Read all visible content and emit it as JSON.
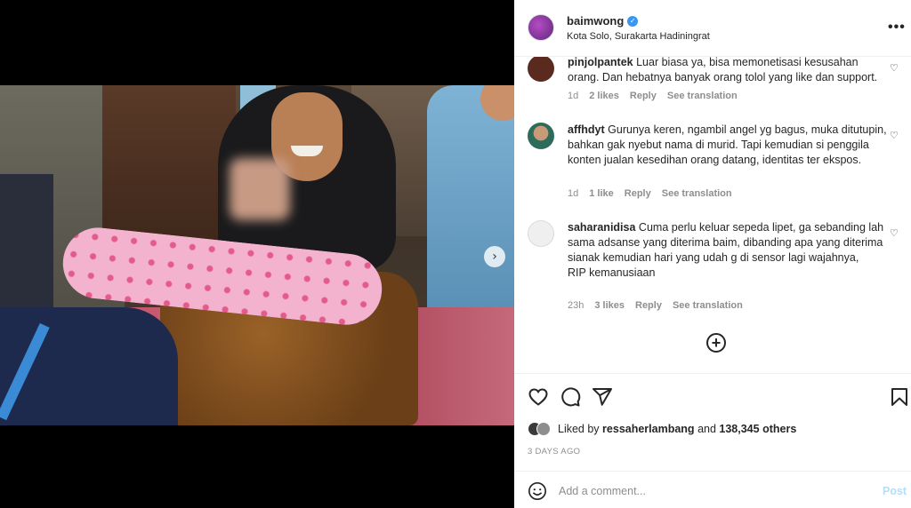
{
  "header": {
    "username": "baimwong",
    "location": "Kota Solo, Surakarta Hadiningrat",
    "verified_icon": "verified-badge-icon",
    "more_icon": "more-options-icon",
    "more_glyph": "•••"
  },
  "media": {
    "next_glyph": "›",
    "dots_count": 4,
    "active_dot": 1
  },
  "comments": [
    {
      "username": "pinjolpantek",
      "text": "Luar biasa ya, bisa memonetisasi kesusahan orang. Dan hebatnya banyak orang tolol yang like dan support.",
      "time": "1d",
      "likes": "2 likes",
      "reply": "Reply",
      "translate": "See translation",
      "avatar_color": "#5a2a1e"
    },
    {
      "username": "affhdyt",
      "text": "Gurunya keren, ngambil angel yg bagus, muka ditutupin, bahkan gak nyebut nama di murid. Tapi kemudian si penggila konten jualan kesedihan orang datang, identitas ter ekspos.",
      "time": "1d",
      "likes": "1 like",
      "reply": "Reply",
      "translate": "See translation",
      "avatar_color": "#2f6b5a"
    },
    {
      "username": "saharanidisa",
      "text": "Cuma perlu keluar sepeda lipet, ga sebanding lah sama adsanse yang diterima baim, dibanding apa yang diterima sianak kemudian hari yang udah g di sensor lagi wajahnya,",
      "text2": "RIP kemanusiaan",
      "time": "23h",
      "likes": "3 likes",
      "reply": "Reply",
      "translate": "See translation",
      "avatar_color": "#dbdbdb"
    }
  ],
  "actions": {
    "like_icon": "heart-icon",
    "comment_icon": "comment-icon",
    "share_icon": "share-icon",
    "save_icon": "bookmark-icon",
    "liked_by_prefix": "Liked by",
    "liked_by_user": "ressaherlambang",
    "liked_by_and": "and",
    "liked_by_others": "138,345 others",
    "date": "3 DAYS AGO"
  },
  "add_comment": {
    "placeholder": "Add a comment...",
    "post_label": "Post",
    "emoji_icon": "emoji-icon"
  },
  "colors": {
    "link_blue_disabled": "#b2dffc",
    "verified_blue": "#3897f0",
    "text_primary": "#262626",
    "text_secondary": "#8e8e8e"
  }
}
